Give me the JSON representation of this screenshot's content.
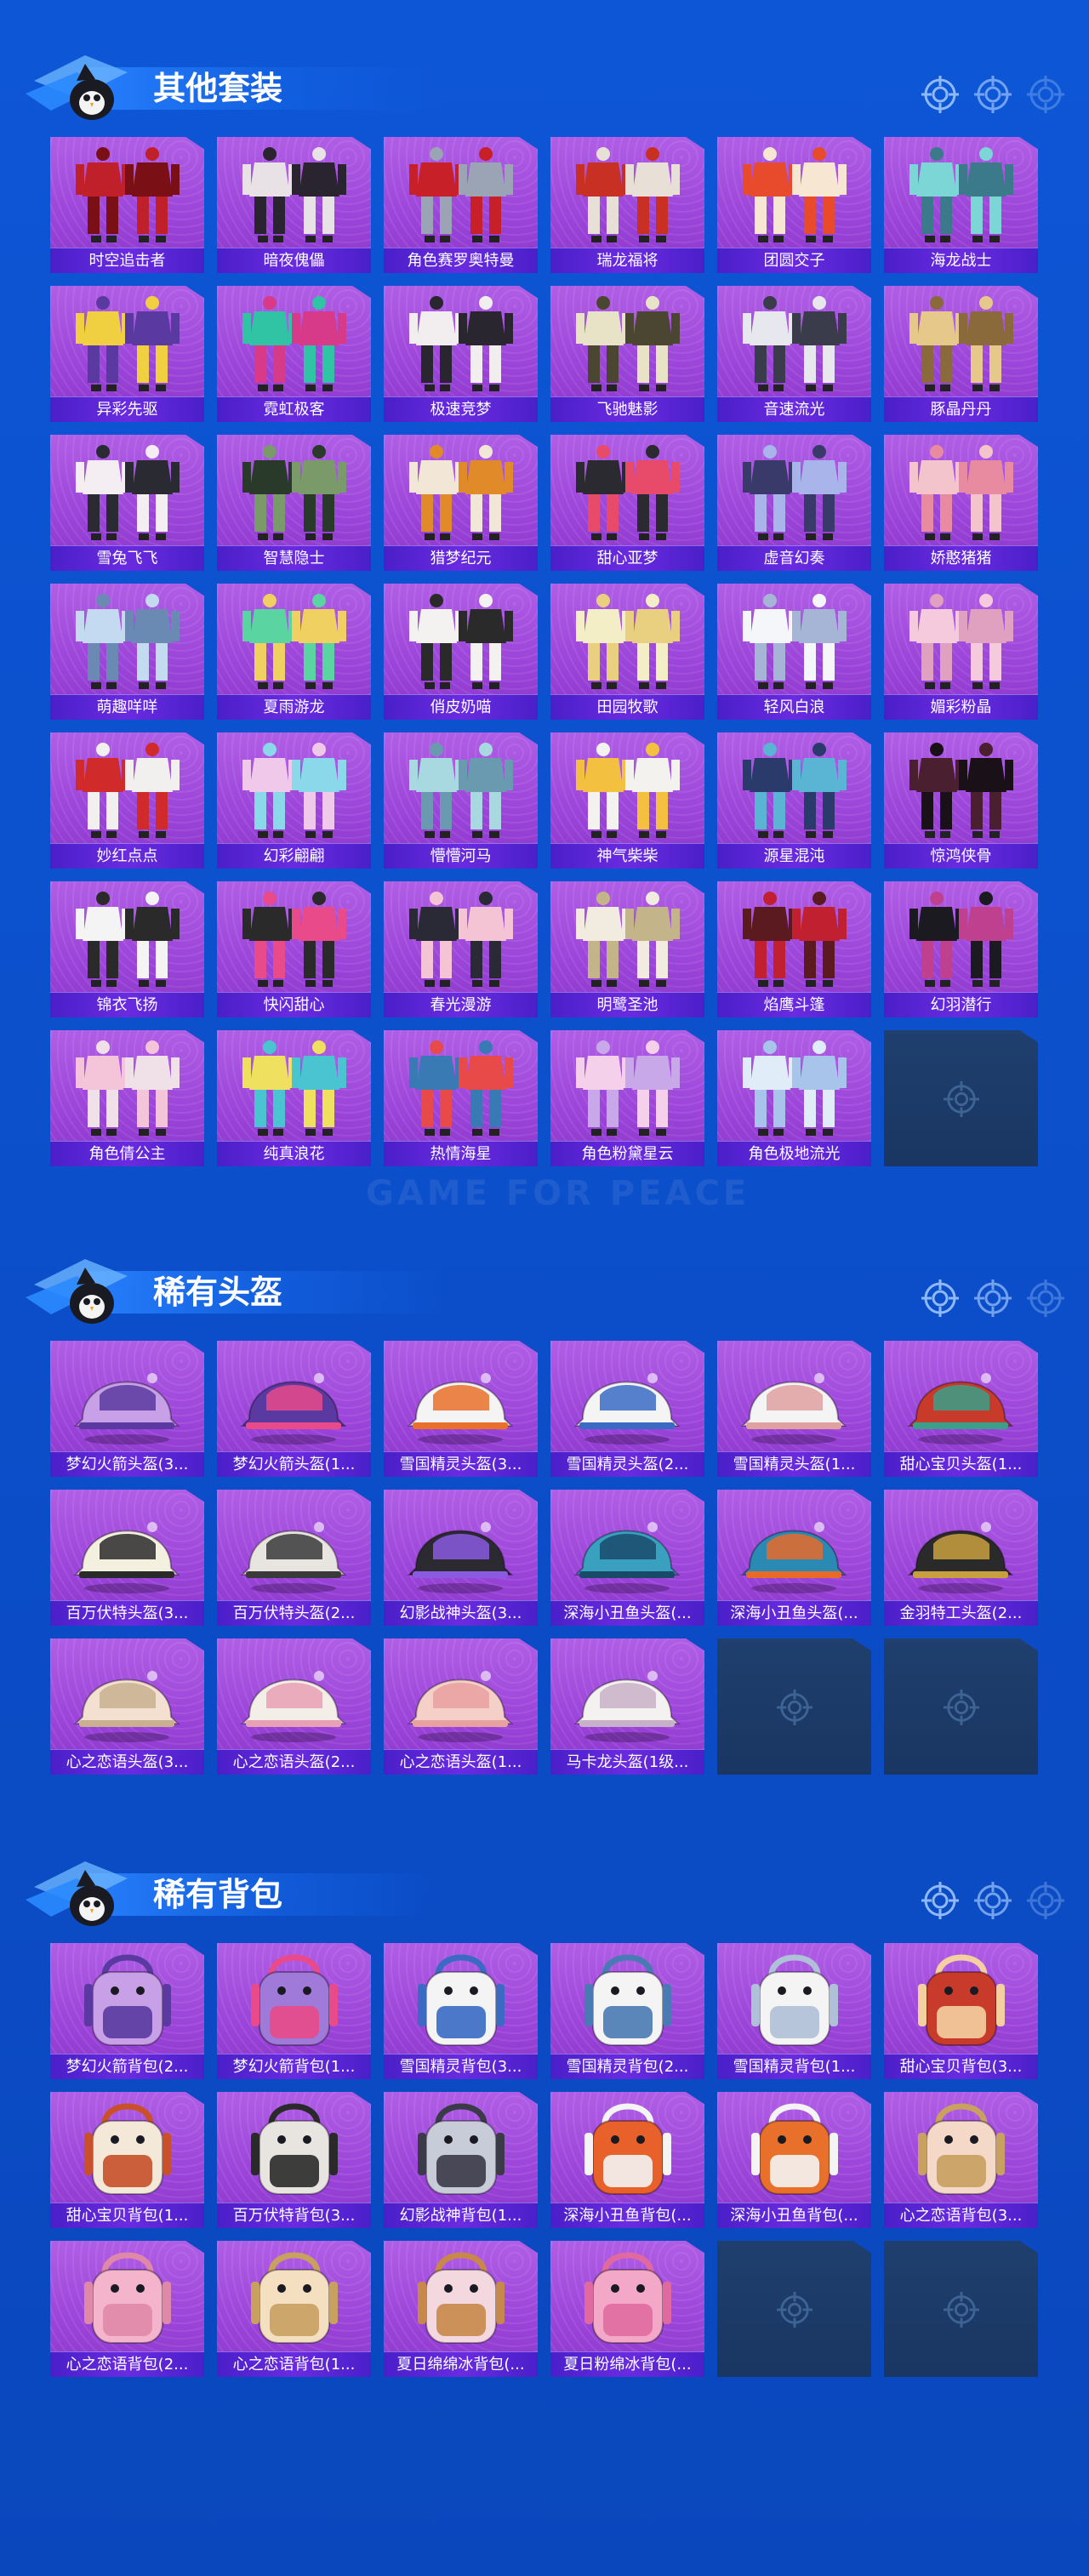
{
  "watermark": "GAME FOR PEACE",
  "colors": {
    "background": "#0c50cc",
    "card_purple": "#9b44d9",
    "label_bar": "#5a25d6",
    "empty_slot": "#1f3f6e"
  },
  "sections": [
    {
      "title": "其他套装",
      "kind": "outfit",
      "items": [
        {
          "name": "时空追击者",
          "palette": [
            "#c0202a",
            "#7a1016"
          ]
        },
        {
          "name": "暗夜傀儡",
          "palette": [
            "#e8e2e6",
            "#2a2430"
          ]
        },
        {
          "name": "角色赛罗奥特曼",
          "palette": [
            "#c82028",
            "#9aa4b4"
          ]
        },
        {
          "name": "瑞龙福将",
          "palette": [
            "#c83024",
            "#e8e0d6"
          ]
        },
        {
          "name": "团圆交子",
          "palette": [
            "#e84a2c",
            "#f6e6d2"
          ]
        },
        {
          "name": "海龙战士",
          "palette": [
            "#7cd6d6",
            "#3a7a8a"
          ]
        },
        {
          "name": "异彩先驱",
          "palette": [
            "#f0d040",
            "#5a3aa0"
          ]
        },
        {
          "name": "霓虹极客",
          "palette": [
            "#30c4a4",
            "#d83a8a"
          ]
        },
        {
          "name": "极速竞梦",
          "palette": [
            "#f2eef0",
            "#2a2630"
          ]
        },
        {
          "name": "飞驰魅影",
          "palette": [
            "#e8e2c6",
            "#4a4632"
          ]
        },
        {
          "name": "音速流光",
          "palette": [
            "#e6e8ee",
            "#3a3c4c"
          ]
        },
        {
          "name": "豚晶丹丹",
          "palette": [
            "#e6c88a",
            "#8a6a3a"
          ]
        },
        {
          "name": "雪兔飞飞",
          "palette": [
            "#f4eef2",
            "#2a2a32"
          ]
        },
        {
          "name": "智慧隐士",
          "palette": [
            "#2a3a2a",
            "#7a9a6a"
          ]
        },
        {
          "name": "猎梦纪元",
          "palette": [
            "#f2e6d6",
            "#e08a2a"
          ]
        },
        {
          "name": "甜心亚梦",
          "palette": [
            "#2a2a30",
            "#e84a6a"
          ]
        },
        {
          "name": "虚音幻奏",
          "palette": [
            "#3a3a6a",
            "#a8b4ea"
          ]
        },
        {
          "name": "娇憨猪猪",
          "palette": [
            "#f4c4cc",
            "#e88aa0"
          ]
        },
        {
          "name": "萌趣咩咩",
          "palette": [
            "#c4daf0",
            "#6a8ab4"
          ]
        },
        {
          "name": "夏雨游龙",
          "palette": [
            "#5ad4a0",
            "#f0d060"
          ]
        },
        {
          "name": "俏皮奶喵",
          "palette": [
            "#f4f2f0",
            "#2a2a2a"
          ]
        },
        {
          "name": "田园牧歌",
          "palette": [
            "#f4eec6",
            "#e8d080"
          ]
        },
        {
          "name": "轻风白浪",
          "palette": [
            "#f4f6fa",
            "#a6b4d6"
          ]
        },
        {
          "name": "媚彩粉晶",
          "palette": [
            "#f4cadc",
            "#e0a0c0"
          ]
        },
        {
          "name": "妙红点点",
          "palette": [
            "#d02a2a",
            "#f2f0ee"
          ]
        },
        {
          "name": "幻彩翩翩",
          "palette": [
            "#f0c8ea",
            "#8ad8ea"
          ]
        },
        {
          "name": "懵懵河马",
          "palette": [
            "#a8d8e0",
            "#6a9ab0"
          ]
        },
        {
          "name": "神气柴柴",
          "palette": [
            "#f4c040",
            "#f4f2ee"
          ]
        },
        {
          "name": "源星混沌",
          "palette": [
            "#2a3a6a",
            "#5ab4d4"
          ]
        },
        {
          "name": "惊鸿侠骨",
          "palette": [
            "#4a2030",
            "#1a1018"
          ]
        },
        {
          "name": "锦衣飞扬",
          "palette": [
            "#f4f4f4",
            "#2a2a2a"
          ]
        },
        {
          "name": "快闪甜心",
          "palette": [
            "#2a2a2a",
            "#e84a8a"
          ]
        },
        {
          "name": "春光漫游",
          "palette": [
            "#2a2a36",
            "#f4c4d4"
          ]
        },
        {
          "name": "明鹭圣池",
          "palette": [
            "#f2ece0",
            "#c4b48a"
          ]
        },
        {
          "name": "焰鹰斗篷",
          "palette": [
            "#5a1a20",
            "#c02030"
          ]
        },
        {
          "name": "幻羽潜行",
          "palette": [
            "#1a1a20",
            "#c04090"
          ]
        },
        {
          "name": "角色倩公主",
          "palette": [
            "#f4c4d8",
            "#f0e0e8"
          ]
        },
        {
          "name": "纯真浪花",
          "palette": [
            "#f0e060",
            "#4ac4d0"
          ]
        },
        {
          "name": "热情海星",
          "palette": [
            "#3a7ab4",
            "#e84a4a"
          ]
        },
        {
          "name": "角色粉黛星云",
          "palette": [
            "#f4d0ea",
            "#c8a8e8"
          ]
        },
        {
          "name": "角色极地流光",
          "palette": [
            "#e0ecf8",
            "#a8c4ea"
          ]
        },
        {
          "name": "",
          "empty": true
        }
      ]
    },
    {
      "title": "稀有头盔",
      "kind": "helmet",
      "items": [
        {
          "name": "梦幻火箭头盔(3...",
          "palette": [
            "#c8a0e8",
            "#5a3aa0"
          ]
        },
        {
          "name": "梦幻火箭头盔(1...",
          "palette": [
            "#5a3aa0",
            "#e84a8a"
          ]
        },
        {
          "name": "雪国精灵头盔(3...",
          "palette": [
            "#f4f4f4",
            "#e8702a"
          ]
        },
        {
          "name": "雪国精灵头盔(2...",
          "palette": [
            "#f4f4f4",
            "#3a6ac4"
          ]
        },
        {
          "name": "雪国精灵头盔(1...",
          "palette": [
            "#f4f4f4",
            "#e0a0a0"
          ]
        },
        {
          "name": "甜心宝贝头盔(1...",
          "palette": [
            "#c83a2a",
            "#3aa08a"
          ]
        },
        {
          "name": "百万伏特头盔(3...",
          "palette": [
            "#f4f0e0",
            "#2a2a2a"
          ]
        },
        {
          "name": "百万伏特头盔(2...",
          "palette": [
            "#e8e4e0",
            "#3a3a3a"
          ]
        },
        {
          "name": "幻影战神头盔(3...",
          "palette": [
            "#2a2a30",
            "#8a5ae0"
          ]
        },
        {
          "name": "深海小丑鱼头盔(...",
          "palette": [
            "#3aa0c0",
            "#1a4a6a"
          ]
        },
        {
          "name": "深海小丑鱼头盔(...",
          "palette": [
            "#2a8ab4",
            "#e86a2a"
          ]
        },
        {
          "name": "金羽特工头盔(2...",
          "palette": [
            "#2a2a2a",
            "#c8a040"
          ]
        },
        {
          "name": "心之恋语头盔(3...",
          "palette": [
            "#f4e0d0",
            "#c8b090"
          ]
        },
        {
          "name": "心之恋语头盔(2...",
          "palette": [
            "#f4eee8",
            "#e8a0b4"
          ]
        },
        {
          "name": "心之恋语头盔(1...",
          "palette": [
            "#f4d0c8",
            "#e8a0a0"
          ]
        },
        {
          "name": "马卡龙头盔(1级...",
          "palette": [
            "#f4f2f0",
            "#c8b0c8"
          ]
        },
        {
          "name": "",
          "empty": true
        },
        {
          "name": "",
          "empty": true
        }
      ]
    },
    {
      "title": "稀有背包",
      "kind": "backpack",
      "items": [
        {
          "name": "梦幻火箭背包(2...",
          "palette": [
            "#c8a0e8",
            "#5a3aa0"
          ]
        },
        {
          "name": "梦幻火箭背包(1...",
          "palette": [
            "#a07ad8",
            "#e84a8a"
          ]
        },
        {
          "name": "雪国精灵背包(3...",
          "palette": [
            "#f4f4f4",
            "#3a6ac4"
          ]
        },
        {
          "name": "雪国精灵背包(2...",
          "palette": [
            "#f4f4f4",
            "#4a7ab4"
          ]
        },
        {
          "name": "雪国精灵背包(1...",
          "palette": [
            "#f4f4f4",
            "#b0c0d8"
          ]
        },
        {
          "name": "甜心宝贝背包(3...",
          "palette": [
            "#c83a2a",
            "#f4d0a0"
          ]
        },
        {
          "name": "甜心宝贝背包(1...",
          "palette": [
            "#f4e8d8",
            "#c8502a"
          ]
        },
        {
          "name": "百万伏特背包(3...",
          "palette": [
            "#e8e4e0",
            "#2a2a2a"
          ]
        },
        {
          "name": "幻影战神背包(1...",
          "palette": [
            "#c8ccd8",
            "#3a3a48"
          ]
        },
        {
          "name": "深海小丑鱼背包(...",
          "palette": [
            "#e8602a",
            "#f4f4f4"
          ]
        },
        {
          "name": "深海小丑鱼背包(...",
          "palette": [
            "#e8702a",
            "#f4f4f4"
          ]
        },
        {
          "name": "心之恋语背包(3...",
          "palette": [
            "#f4d8c8",
            "#c8a060"
          ]
        },
        {
          "name": "心之恋语背包(2...",
          "palette": [
            "#f4b4cc",
            "#e088a8"
          ]
        },
        {
          "name": "心之恋语背包(1...",
          "palette": [
            "#f4e0c0",
            "#c8a060"
          ]
        },
        {
          "name": "夏日绵绵冰背包(...",
          "palette": [
            "#f4d8e0",
            "#c8884a"
          ]
        },
        {
          "name": "夏日粉绵冰背包(...",
          "palette": [
            "#f4a8c8",
            "#e06aa0"
          ]
        },
        {
          "name": "",
          "empty": true
        },
        {
          "name": "",
          "empty": true
        }
      ]
    }
  ]
}
